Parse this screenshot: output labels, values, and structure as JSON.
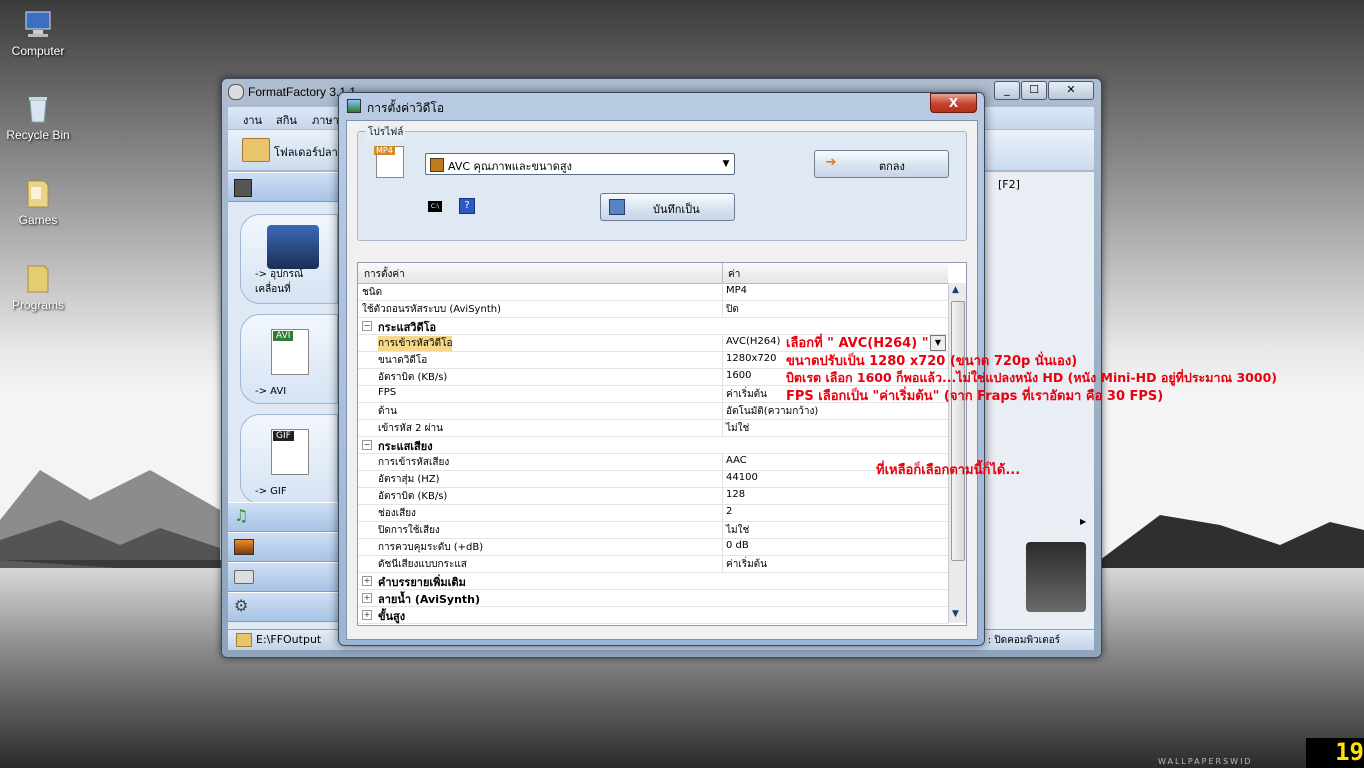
{
  "desktop": {
    "icons": [
      {
        "label": "Computer",
        "icon": "computer-icon"
      },
      {
        "label": "Recycle Bin",
        "icon": "recycle-bin-icon"
      },
      {
        "label": "Games",
        "icon": "games-folder-icon"
      },
      {
        "label": "Programs",
        "icon": "folder-icon"
      }
    ],
    "clock": "19",
    "watermark": "WALLPAPERSWID"
  },
  "main_window": {
    "title": "FormatFactory 3.1.1",
    "menu": [
      "งาน",
      "สกิน",
      "ภาษา"
    ],
    "toolbar_folder": "โฟลเดอร์ปลาย",
    "side_tiles": [
      {
        "label": "-> อุปกรณ์เคลื่อนที่"
      },
      {
        "label": "-> AVI",
        "badge": "AVI"
      },
      {
        "label": "-> GIF",
        "badge": "GIF"
      }
    ],
    "right_column": "[F2]",
    "status_left": "E:\\FFOutput",
    "status_right": "ม : ปิดคอมพิวเตอร์",
    "title_buttons": [
      "_",
      "☐",
      "✕"
    ]
  },
  "dialog": {
    "title": "การตั้งค่าวิดีโอ",
    "close_label": "X",
    "profile_label": "โปรไฟล์",
    "format_icon_badge": "MP4",
    "format_selected": "AVC คุณภาพและขนาดสูง",
    "ok_label": "ตกลง",
    "save_as_label": "บันทึกเป็น",
    "help_label": "?",
    "cmd_label": "C:\\",
    "grid": {
      "col_setting": "การตั้งค่า",
      "col_value": "ค่า",
      "rows": [
        {
          "key": "ชนิด",
          "value": "MP4",
          "level": 0
        },
        {
          "key": "ใช้ตัวถอนรหัสระบบ (AviSynth)",
          "value": "ปิด",
          "level": 0
        },
        {
          "key": "กระแสวิดีโอ",
          "value": "",
          "group": true,
          "expanded": true
        },
        {
          "key": "การเข้ารหัสวิดีโอ",
          "value": "AVC(H264)",
          "level": 1,
          "selected": true
        },
        {
          "key": "ขนาดวิดีโอ",
          "value": "1280x720",
          "level": 1
        },
        {
          "key": "อัตราบิต (KB/s)",
          "value": "1600",
          "level": 1
        },
        {
          "key": "FPS",
          "value": "ค่าเริ่มต้น",
          "level": 1
        },
        {
          "key": "ด้าน",
          "value": "อัตโนมัติ(ความกว้าง)",
          "level": 1
        },
        {
          "key": "เข้ารหัส 2 ผ่าน",
          "value": "ไม่ใช่",
          "level": 1
        },
        {
          "key": "กระแสเสียง",
          "value": "",
          "group": true,
          "expanded": true
        },
        {
          "key": "การเข้ารหัสเสียง",
          "value": "AAC",
          "level": 1
        },
        {
          "key": "อัตราสุ่ม (HZ)",
          "value": "44100",
          "level": 1
        },
        {
          "key": "อัตราบิต (KB/s)",
          "value": "128",
          "level": 1
        },
        {
          "key": "ช่องเสียง",
          "value": "2",
          "level": 1
        },
        {
          "key": "ปิดการใช้เสียง",
          "value": "ไม่ใช่",
          "level": 1
        },
        {
          "key": "การควบคุมระดับ (+dB)",
          "value": "0 dB",
          "level": 1
        },
        {
          "key": "ดัชนีเสียงแบบกระแส",
          "value": "ค่าเริ่มต้น",
          "level": 1
        },
        {
          "key": "คำบรรยายเพิ่มเติม",
          "value": "",
          "group": true,
          "expanded": false
        },
        {
          "key": "ลายน้ำ (AviSynth)",
          "value": "",
          "group": true,
          "expanded": false
        },
        {
          "key": "ขั้นสูง",
          "value": "",
          "group": true,
          "expanded": false
        }
      ]
    }
  },
  "annotations": [
    "เลือกที่ \" AVC(H264) \"",
    "ขนาดปรับเป็น 1280 x720 (ขนาด 720p นั่นเอง)",
    "บิตเรต เลือก 1600 ก็พอแล้ว...ไม่ใช่แปลงหนัง HD (หนัง Mini-HD อยู่ที่ประมาณ 3000)",
    "FPS เลือกเป็น \"ค่าเริ่มต้น\" (จาก Fraps ที่เราอัดมา คือ 30 FPS)",
    "ที่เหลือก็เลือกตามนี้ก็ได้..."
  ],
  "colors": {
    "annotation": "#e8000e",
    "selected_row": "#f7d88a",
    "clock_text": "#ffe400"
  }
}
